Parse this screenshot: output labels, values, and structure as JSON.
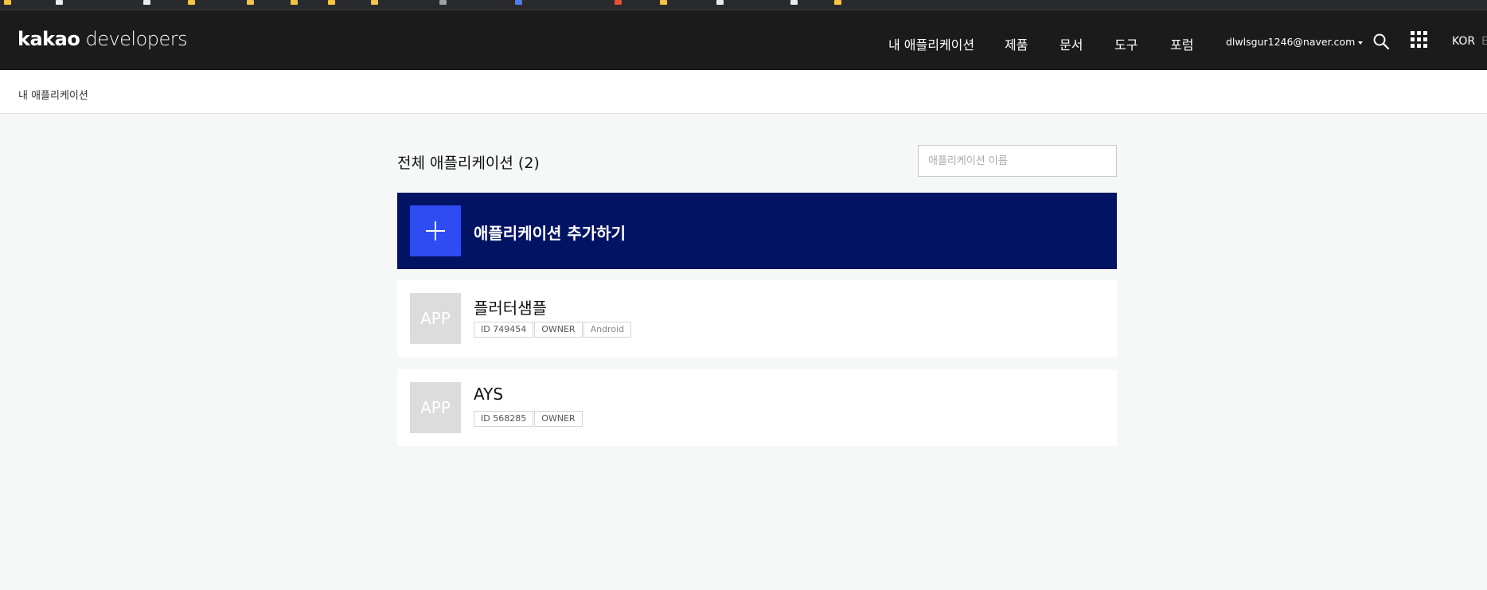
{
  "header": {
    "logo_brand": "kakao",
    "logo_suffix": "developers",
    "nav": [
      {
        "label": "내 애플리케이션"
      },
      {
        "label": "제품"
      },
      {
        "label": "문서"
      },
      {
        "label": "도구"
      },
      {
        "label": "포럼"
      }
    ],
    "account_email": "dlwlsgur1246@naver.com",
    "lang_current": "KOR",
    "lang_other": "E"
  },
  "breadcrumb": {
    "current": "내 애플리케이션"
  },
  "main": {
    "title": "전체 애플리케이션 (2)",
    "search_placeholder": "애플리케이션 이름",
    "add_label": "애플리케이션 추가하기",
    "apps": [
      {
        "thumb": "APP",
        "name": "플러터샘플",
        "id_tag": "ID 749454",
        "role": "OWNER",
        "platform": "Android"
      },
      {
        "thumb": "APP",
        "name": "AYS",
        "id_tag": "ID 568285",
        "role": "OWNER"
      }
    ]
  },
  "colors": {
    "nav_bg": "#1b1b1c",
    "add_card_bg": "#031363",
    "plus_bg": "#2f4cf2",
    "page_bg": "#f6f7f7"
  }
}
